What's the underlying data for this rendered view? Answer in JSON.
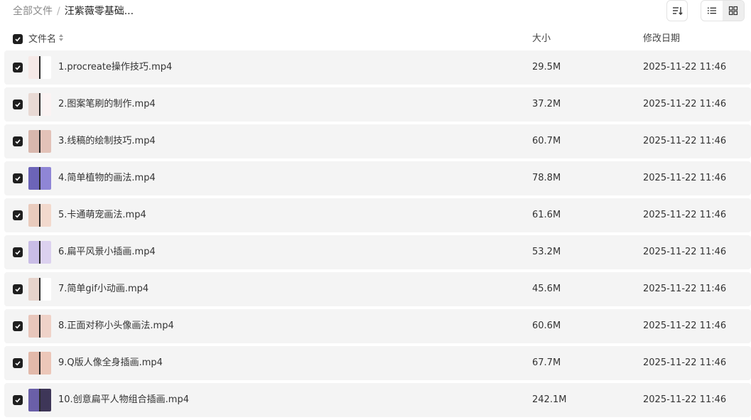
{
  "breadcrumb": {
    "root": "全部文件",
    "separator": "/",
    "current": "汪紫薇零基础..."
  },
  "toolbar": {
    "sort_icon": "sort-icon",
    "list_view_icon": "list-view-icon",
    "grid_view_icon": "grid-view-icon",
    "active_view": "grid"
  },
  "table": {
    "columns": {
      "name": "文件名",
      "size": "大小",
      "modified": "修改日期"
    },
    "all_selected": true,
    "rows": [
      {
        "name": "1.procreate操作技巧.mp4",
        "size": "29.5M",
        "date": "2025-11-22 11:46",
        "checked": true
      },
      {
        "name": "2.图案笔刷的制作.mp4",
        "size": "37.2M",
        "date": "2025-11-22 11:46",
        "checked": true
      },
      {
        "name": "3.线稿的绘制技巧.mp4",
        "size": "60.7M",
        "date": "2025-11-22 11:46",
        "checked": true
      },
      {
        "name": "4.简单植物的画法.mp4",
        "size": "78.8M",
        "date": "2025-11-22 11:46",
        "checked": true
      },
      {
        "name": "5.卡通萌宠画法.mp4",
        "size": "61.6M",
        "date": "2025-11-22 11:46",
        "checked": true
      },
      {
        "name": "6.扁平风景小插画.mp4",
        "size": "53.2M",
        "date": "2025-11-22 11:46",
        "checked": true
      },
      {
        "name": "7.简单gif小动画.mp4",
        "size": "45.6M",
        "date": "2025-11-22 11:46",
        "checked": true
      },
      {
        "name": "8.正面对称小头像画法.mp4",
        "size": "60.6M",
        "date": "2025-11-22 11:46",
        "checked": true
      },
      {
        "name": "9.Q版人像全身插画.mp4",
        "size": "67.7M",
        "date": "2025-11-22 11:46",
        "checked": true
      },
      {
        "name": "10.创意扁平人物组合插画.mp4",
        "size": "242.1M",
        "date": "2025-11-22 11:46",
        "checked": true
      }
    ]
  },
  "colors": {
    "row_background": "#f4f4f4",
    "checkbox": "#1f1f1f",
    "muted_text": "#8a8a8a"
  }
}
